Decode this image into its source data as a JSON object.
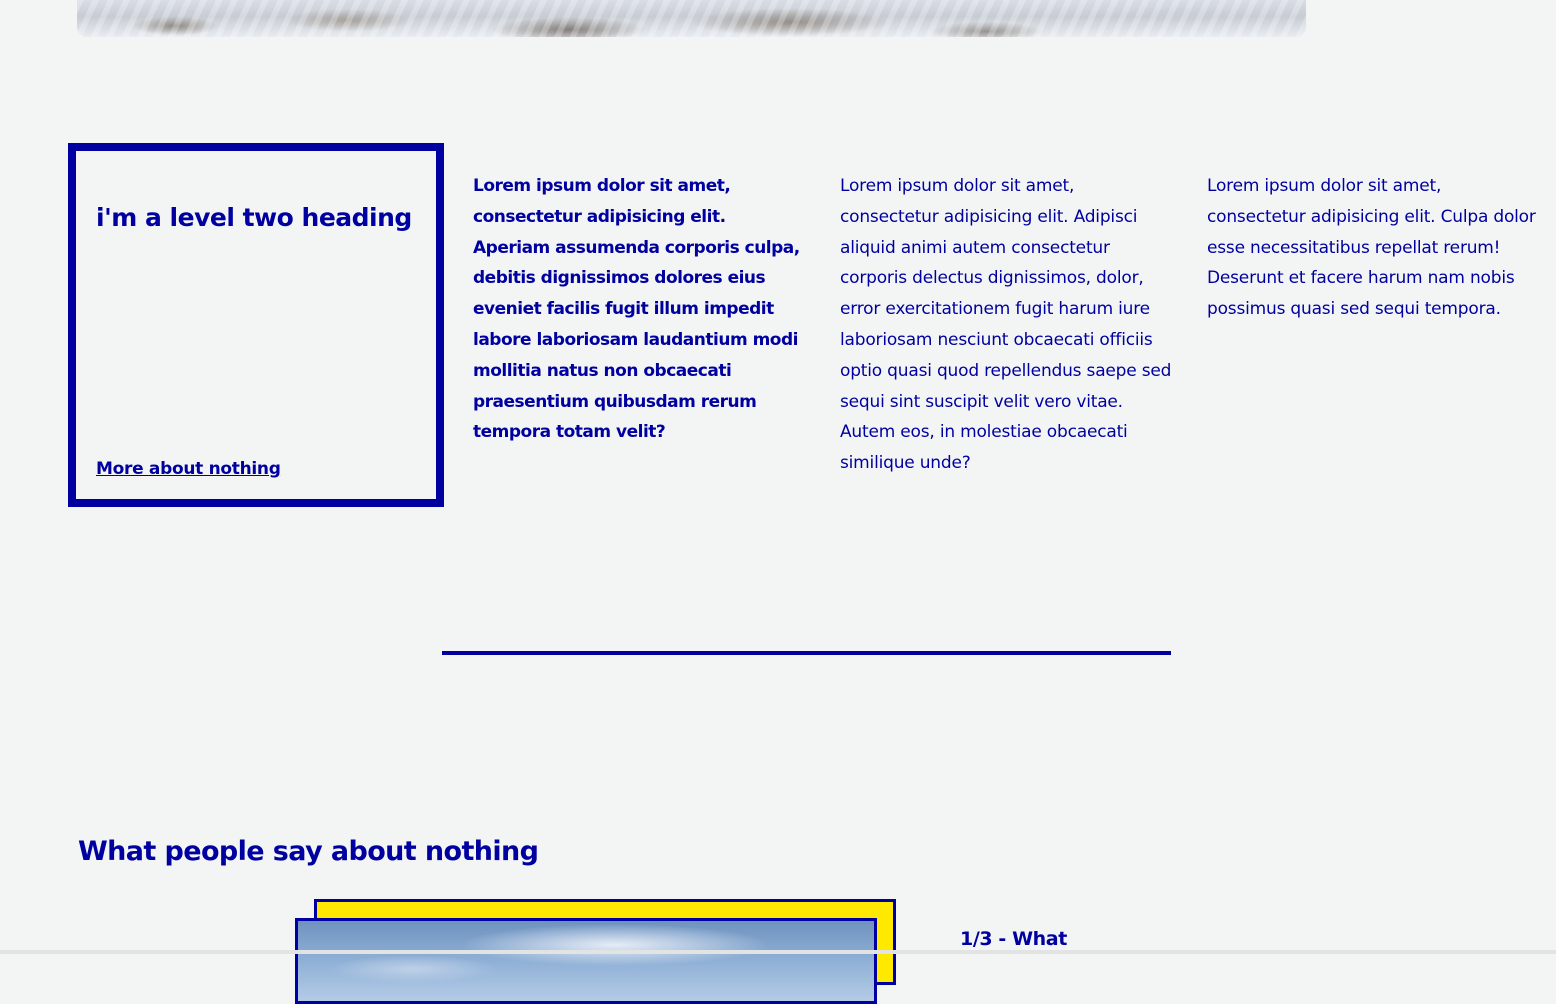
{
  "hero": {
    "image_name": "snowy-rocks-image"
  },
  "card": {
    "heading": "i'm a level two heading",
    "link_label": "More about nothing"
  },
  "columns": [
    "Lorem ipsum dolor sit amet, consectetur adipisicing elit. Aperiam assumenda corporis culpa, debitis dignissimos dolores eius eveniet facilis fugit illum impedit labore laboriosam laudantium modi mollitia natus non obcaecati praesentium quibusdam rerum tempora totam velit?",
    "Lorem ipsum dolor sit amet, consectetur adipisicing elit. Adipisci aliquid animi autem consectetur corporis delectus dignissimos, dolor, error exercitationem fugit harum iure laboriosam nesciunt obcaecati officiis optio quasi quod repellendus saepe sed sequi sint suscipit velit vero vitae. Autem eos, in molestiae obcaecati similique unde?",
    "Lorem ipsum dolor sit amet, consectetur adipisicing elit. Culpa dolor esse necessitatibus repellat rerum! Deserunt et facere harum nam nobis possimus quasi sed sequi tempora."
  ],
  "testimonials": {
    "heading": "What people say about nothing",
    "slide_label": "1/3 - What"
  },
  "colors": {
    "accent": "#0000a0",
    "highlight": "#ffe900",
    "background": "#f3f5f4"
  }
}
